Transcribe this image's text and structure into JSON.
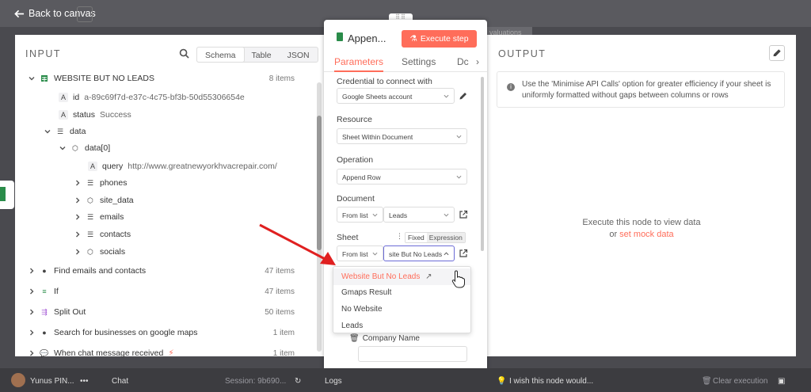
{
  "topbar": {
    "back_label": "Back to canvas",
    "evaluations_tab": "valuations"
  },
  "input_panel": {
    "title": "INPUT",
    "tabs": [
      "Schema",
      "Table",
      "JSON"
    ],
    "active_tab": "Schema",
    "root": {
      "label": "WEBSITE BUT NO LEADS",
      "count": "8 items"
    },
    "fields": [
      {
        "key": "id",
        "value": "a-89c69f7d-e37c-4c75-bf3b-50d55306654e"
      },
      {
        "key": "status",
        "value": "Success"
      }
    ],
    "data_label": "data",
    "data0_label": "data[0]",
    "query": {
      "key": "query",
      "value": "http://www.greatnewyorkhvacrepair.com/"
    },
    "children": [
      "phones",
      "site_data",
      "emails",
      "contacts",
      "socials"
    ],
    "nodes": [
      {
        "label": "Find emails and contacts",
        "count": "47 items"
      },
      {
        "label": "If",
        "count": "47 items"
      },
      {
        "label": "Split Out",
        "count": "50 items"
      },
      {
        "label": "Search for businesses on google maps",
        "count": "1 item"
      },
      {
        "label": "When chat message received",
        "count": "1 item"
      }
    ]
  },
  "node_panel": {
    "title": "Appen...",
    "execute_label": "Execute step",
    "tabs": {
      "parameters": "Parameters",
      "settings": "Settings",
      "docs": "Dc"
    },
    "credential": {
      "label": "Credential to connect with",
      "value": "Google Sheets account"
    },
    "resource": {
      "label": "Resource",
      "value": "Sheet Within Document"
    },
    "operation": {
      "label": "Operation",
      "value": "Append Row"
    },
    "document": {
      "label": "Document",
      "mode": "From list",
      "value": "Leads"
    },
    "sheet": {
      "label": "Sheet",
      "mode": "From list",
      "value": "site But No Leads",
      "fixed": "Fixed",
      "expression": "Expression"
    },
    "dropdown_options": [
      "Website But No Leads",
      "Gmaps Result",
      "No Website",
      "Leads"
    ],
    "column_label": "Company Name"
  },
  "output_panel": {
    "title": "OUTPUT",
    "info": "Use the 'Minimise API Calls' option for greater efficiency if your sheet is uniformly formatted without gaps between columns or rows",
    "empty_line1": "Execute this node to view data",
    "empty_or": "or",
    "empty_link": "set mock data"
  },
  "bottombar": {
    "user": "Yunus PIN...",
    "chat": "Chat",
    "session": "Session: 9b690...",
    "logs": "Logs",
    "feedback": "I wish this node would...",
    "clear": "Clear execution"
  },
  "colors": {
    "accent": "#ff6d5a",
    "sheets_green": "#2a8c4a"
  }
}
